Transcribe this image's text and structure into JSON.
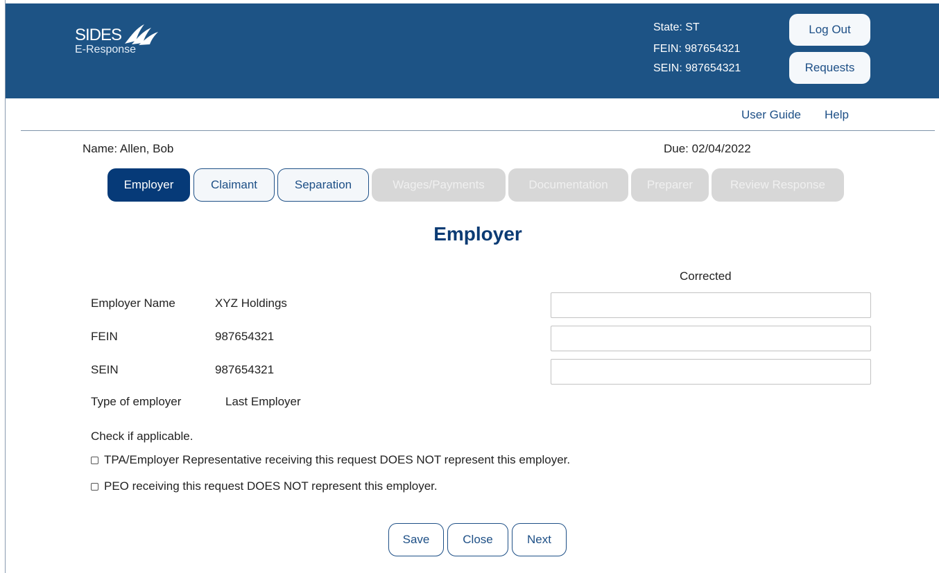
{
  "header": {
    "logo_main": "SIDES",
    "logo_sub": "E-Response",
    "state": "State: ST",
    "fein": "FEIN: 987654321",
    "sein": "SEIN: 987654321",
    "logout_label": "Log Out",
    "requests_label": "Requests",
    "bg_color": "#1d5385"
  },
  "links": {
    "user_guide": "User Guide",
    "help": "Help"
  },
  "claim": {
    "name": "Name:  Allen, Bob",
    "due": "Due:  02/04/2022"
  },
  "tabs": [
    {
      "label": "Employer",
      "state": "active"
    },
    {
      "label": "Claimant",
      "state": "enabled"
    },
    {
      "label": "Separation",
      "state": "enabled"
    },
    {
      "label": "Wages/Payments",
      "state": "disabled"
    },
    {
      "label": "Documentation",
      "state": "disabled"
    },
    {
      "label": "Preparer",
      "state": "disabled"
    },
    {
      "label": "Review Response",
      "state": "disabled"
    }
  ],
  "section": {
    "title": "Employer",
    "corrected_header": "Corrected"
  },
  "fields": [
    {
      "label": "Employer Name",
      "value": "XYZ Holdings",
      "corrected": ""
    },
    {
      "label": "FEIN",
      "value": "987654321",
      "corrected": ""
    },
    {
      "label": "SEIN",
      "value": "987654321",
      "corrected": ""
    },
    {
      "label": "Type of employer",
      "value": "Last Employer"
    }
  ],
  "checks": {
    "intro": "Check if applicable.",
    "items": [
      {
        "label": "TPA/Employer Representative receiving this request DOES NOT represent this employer.",
        "checked": false
      },
      {
        "label": "PEO receiving this request DOES NOT represent this employer.",
        "checked": false
      }
    ]
  },
  "actions": {
    "save": "Save",
    "close": "Close",
    "next": "Next"
  },
  "colors": {
    "accent": "#063a78",
    "link": "#1d4f86",
    "disabled_tab": "#d7d7d7"
  }
}
